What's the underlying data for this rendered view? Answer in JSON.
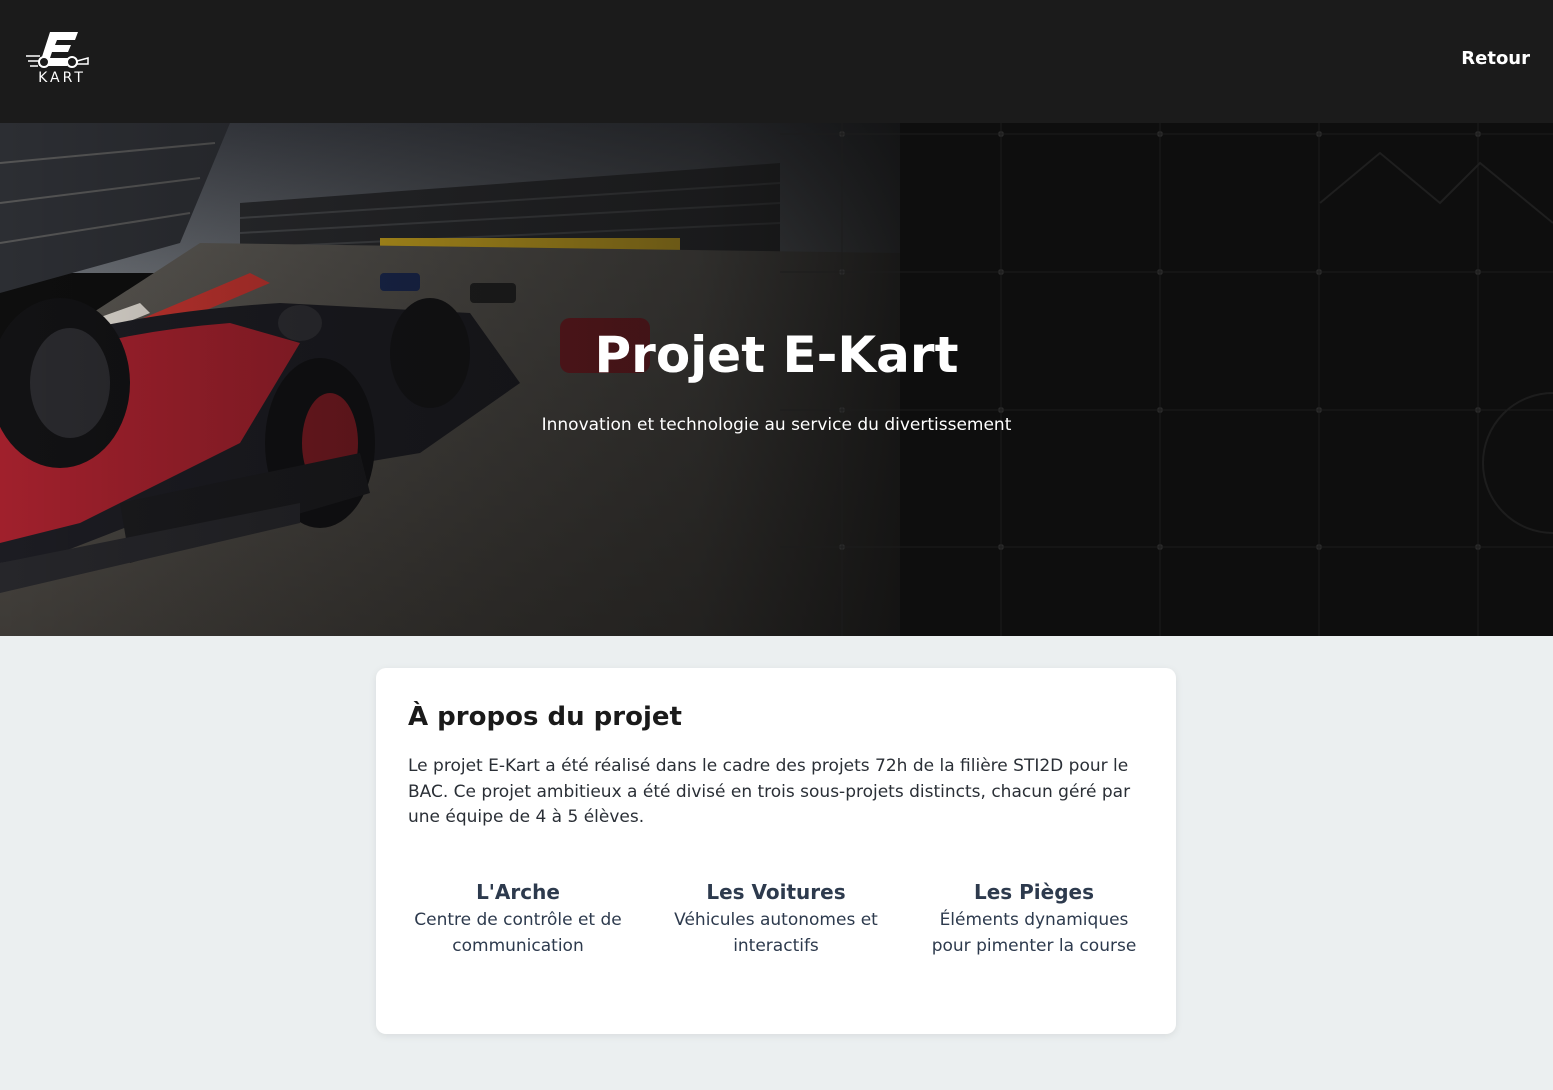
{
  "header": {
    "logo_text": "KART",
    "back_label": "Retour"
  },
  "hero": {
    "title": "Projet E-Kart",
    "subtitle": "Innovation et technologie au service du divertissement"
  },
  "about": {
    "title": "À propos du projet",
    "text": "Le projet E-Kart a été réalisé dans le cadre des projets 72h de la filière STI2D pour le BAC. Ce projet ambitieux a été divisé en trois sous-projets distincts, chacun géré par une équipe de 4 à 5 élèves.",
    "features": [
      {
        "title": "L'Arche",
        "description": "Centre de contrôle et de communication"
      },
      {
        "title": "Les Voitures",
        "description": "Véhicules autonomes et interactifs"
      },
      {
        "title": "Les Pièges",
        "description": "Éléments dynamiques pour pimenter la course"
      }
    ]
  },
  "colors": {
    "header_bg": "#1b1b1b",
    "page_bg": "#ebeff0",
    "card_bg": "#ffffff",
    "feature_text": "#2d3a4d",
    "car_red": "#a0202c"
  }
}
